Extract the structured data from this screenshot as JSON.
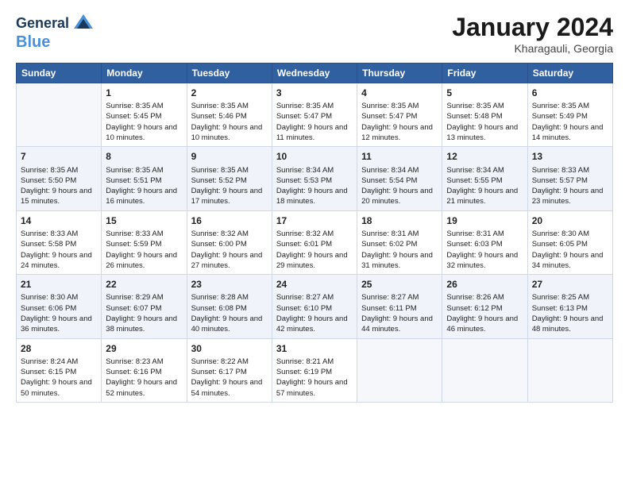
{
  "header": {
    "logo_line1": "General",
    "logo_line2": "Blue",
    "month": "January 2024",
    "location": "Kharagauli, Georgia"
  },
  "weekdays": [
    "Sunday",
    "Monday",
    "Tuesday",
    "Wednesday",
    "Thursday",
    "Friday",
    "Saturday"
  ],
  "weeks": [
    [
      {
        "day": "",
        "empty": true
      },
      {
        "day": "1",
        "sunrise": "Sunrise: 8:35 AM",
        "sunset": "Sunset: 5:45 PM",
        "daylight": "Daylight: 9 hours and 10 minutes."
      },
      {
        "day": "2",
        "sunrise": "Sunrise: 8:35 AM",
        "sunset": "Sunset: 5:46 PM",
        "daylight": "Daylight: 9 hours and 10 minutes."
      },
      {
        "day": "3",
        "sunrise": "Sunrise: 8:35 AM",
        "sunset": "Sunset: 5:47 PM",
        "daylight": "Daylight: 9 hours and 11 minutes."
      },
      {
        "day": "4",
        "sunrise": "Sunrise: 8:35 AM",
        "sunset": "Sunset: 5:47 PM",
        "daylight": "Daylight: 9 hours and 12 minutes."
      },
      {
        "day": "5",
        "sunrise": "Sunrise: 8:35 AM",
        "sunset": "Sunset: 5:48 PM",
        "daylight": "Daylight: 9 hours and 13 minutes."
      },
      {
        "day": "6",
        "sunrise": "Sunrise: 8:35 AM",
        "sunset": "Sunset: 5:49 PM",
        "daylight": "Daylight: 9 hours and 14 minutes."
      }
    ],
    [
      {
        "day": "7",
        "sunrise": "Sunrise: 8:35 AM",
        "sunset": "Sunset: 5:50 PM",
        "daylight": "Daylight: 9 hours and 15 minutes."
      },
      {
        "day": "8",
        "sunrise": "Sunrise: 8:35 AM",
        "sunset": "Sunset: 5:51 PM",
        "daylight": "Daylight: 9 hours and 16 minutes."
      },
      {
        "day": "9",
        "sunrise": "Sunrise: 8:35 AM",
        "sunset": "Sunset: 5:52 PM",
        "daylight": "Daylight: 9 hours and 17 minutes."
      },
      {
        "day": "10",
        "sunrise": "Sunrise: 8:34 AM",
        "sunset": "Sunset: 5:53 PM",
        "daylight": "Daylight: 9 hours and 18 minutes."
      },
      {
        "day": "11",
        "sunrise": "Sunrise: 8:34 AM",
        "sunset": "Sunset: 5:54 PM",
        "daylight": "Daylight: 9 hours and 20 minutes."
      },
      {
        "day": "12",
        "sunrise": "Sunrise: 8:34 AM",
        "sunset": "Sunset: 5:55 PM",
        "daylight": "Daylight: 9 hours and 21 minutes."
      },
      {
        "day": "13",
        "sunrise": "Sunrise: 8:33 AM",
        "sunset": "Sunset: 5:57 PM",
        "daylight": "Daylight: 9 hours and 23 minutes."
      }
    ],
    [
      {
        "day": "14",
        "sunrise": "Sunrise: 8:33 AM",
        "sunset": "Sunset: 5:58 PM",
        "daylight": "Daylight: 9 hours and 24 minutes."
      },
      {
        "day": "15",
        "sunrise": "Sunrise: 8:33 AM",
        "sunset": "Sunset: 5:59 PM",
        "daylight": "Daylight: 9 hours and 26 minutes."
      },
      {
        "day": "16",
        "sunrise": "Sunrise: 8:32 AM",
        "sunset": "Sunset: 6:00 PM",
        "daylight": "Daylight: 9 hours and 27 minutes."
      },
      {
        "day": "17",
        "sunrise": "Sunrise: 8:32 AM",
        "sunset": "Sunset: 6:01 PM",
        "daylight": "Daylight: 9 hours and 29 minutes."
      },
      {
        "day": "18",
        "sunrise": "Sunrise: 8:31 AM",
        "sunset": "Sunset: 6:02 PM",
        "daylight": "Daylight: 9 hours and 31 minutes."
      },
      {
        "day": "19",
        "sunrise": "Sunrise: 8:31 AM",
        "sunset": "Sunset: 6:03 PM",
        "daylight": "Daylight: 9 hours and 32 minutes."
      },
      {
        "day": "20",
        "sunrise": "Sunrise: 8:30 AM",
        "sunset": "Sunset: 6:05 PM",
        "daylight": "Daylight: 9 hours and 34 minutes."
      }
    ],
    [
      {
        "day": "21",
        "sunrise": "Sunrise: 8:30 AM",
        "sunset": "Sunset: 6:06 PM",
        "daylight": "Daylight: 9 hours and 36 minutes."
      },
      {
        "day": "22",
        "sunrise": "Sunrise: 8:29 AM",
        "sunset": "Sunset: 6:07 PM",
        "daylight": "Daylight: 9 hours and 38 minutes."
      },
      {
        "day": "23",
        "sunrise": "Sunrise: 8:28 AM",
        "sunset": "Sunset: 6:08 PM",
        "daylight": "Daylight: 9 hours and 40 minutes."
      },
      {
        "day": "24",
        "sunrise": "Sunrise: 8:27 AM",
        "sunset": "Sunset: 6:10 PM",
        "daylight": "Daylight: 9 hours and 42 minutes."
      },
      {
        "day": "25",
        "sunrise": "Sunrise: 8:27 AM",
        "sunset": "Sunset: 6:11 PM",
        "daylight": "Daylight: 9 hours and 44 minutes."
      },
      {
        "day": "26",
        "sunrise": "Sunrise: 8:26 AM",
        "sunset": "Sunset: 6:12 PM",
        "daylight": "Daylight: 9 hours and 46 minutes."
      },
      {
        "day": "27",
        "sunrise": "Sunrise: 8:25 AM",
        "sunset": "Sunset: 6:13 PM",
        "daylight": "Daylight: 9 hours and 48 minutes."
      }
    ],
    [
      {
        "day": "28",
        "sunrise": "Sunrise: 8:24 AM",
        "sunset": "Sunset: 6:15 PM",
        "daylight": "Daylight: 9 hours and 50 minutes."
      },
      {
        "day": "29",
        "sunrise": "Sunrise: 8:23 AM",
        "sunset": "Sunset: 6:16 PM",
        "daylight": "Daylight: 9 hours and 52 minutes."
      },
      {
        "day": "30",
        "sunrise": "Sunrise: 8:22 AM",
        "sunset": "Sunset: 6:17 PM",
        "daylight": "Daylight: 9 hours and 54 minutes."
      },
      {
        "day": "31",
        "sunrise": "Sunrise: 8:21 AM",
        "sunset": "Sunset: 6:19 PM",
        "daylight": "Daylight: 9 hours and 57 minutes."
      },
      {
        "day": "",
        "empty": true
      },
      {
        "day": "",
        "empty": true
      },
      {
        "day": "",
        "empty": true
      }
    ]
  ]
}
